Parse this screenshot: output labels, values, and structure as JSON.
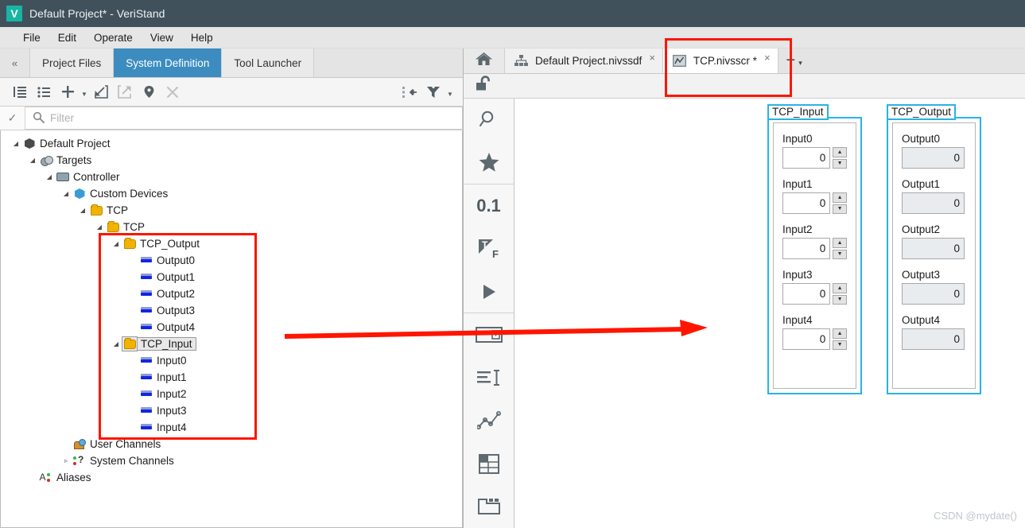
{
  "window": {
    "logo_letter": "V",
    "title": "Default Project* - VeriStand"
  },
  "menu": {
    "items": [
      {
        "label": "File"
      },
      {
        "label": "Edit"
      },
      {
        "label": "Operate"
      },
      {
        "label": "View"
      },
      {
        "label": "Help"
      }
    ]
  },
  "left_pane": {
    "collapse_label": "«",
    "tabs": [
      {
        "label": "Project Files",
        "active": false
      },
      {
        "label": "System Definition",
        "active": true
      },
      {
        "label": "Tool Launcher",
        "active": false
      }
    ],
    "toolbar": {
      "icons": [
        "collapse-all-icon",
        "list-view-icon",
        "add-icon",
        "add-dropdown-caret",
        "import-icon",
        "export-icon",
        "pin-icon",
        "delete-icon",
        "synchronize-icon",
        "filter-icon",
        "filter-dropdown-caret"
      ]
    },
    "filter": {
      "check_glyph": "✓",
      "placeholder": "Filter",
      "value": ""
    },
    "tree": [
      {
        "label": "Default Project",
        "depth": 0,
        "icon": "cube",
        "arrow": "expanded"
      },
      {
        "label": "Targets",
        "depth": 1,
        "icon": "targets",
        "arrow": "expanded"
      },
      {
        "label": "Controller",
        "depth": 2,
        "icon": "controller",
        "arrow": "expanded"
      },
      {
        "label": "Custom Devices",
        "depth": 3,
        "icon": "customdevice",
        "arrow": "expanded"
      },
      {
        "label": "TCP",
        "depth": 4,
        "icon": "folder",
        "arrow": "expanded"
      },
      {
        "label": "TCP",
        "depth": 5,
        "icon": "folder",
        "arrow": "expanded"
      },
      {
        "label": "TCP_Output",
        "depth": 6,
        "icon": "folder",
        "arrow": "expanded"
      },
      {
        "label": "Output0",
        "depth": 7,
        "icon": "channel",
        "arrow": "none"
      },
      {
        "label": "Output1",
        "depth": 7,
        "icon": "channel",
        "arrow": "none"
      },
      {
        "label": "Output2",
        "depth": 7,
        "icon": "channel",
        "arrow": "none"
      },
      {
        "label": "Output3",
        "depth": 7,
        "icon": "channel",
        "arrow": "none"
      },
      {
        "label": "Output4",
        "depth": 7,
        "icon": "channel",
        "arrow": "none"
      },
      {
        "label": "TCP_Input",
        "depth": 6,
        "icon": "folder",
        "arrow": "expanded",
        "selected": true
      },
      {
        "label": "Input0",
        "depth": 7,
        "icon": "channel",
        "arrow": "none"
      },
      {
        "label": "Input1",
        "depth": 7,
        "icon": "channel",
        "arrow": "none"
      },
      {
        "label": "Input2",
        "depth": 7,
        "icon": "channel",
        "arrow": "none"
      },
      {
        "label": "Input3",
        "depth": 7,
        "icon": "channel",
        "arrow": "none"
      },
      {
        "label": "Input4",
        "depth": 7,
        "icon": "channel",
        "arrow": "none"
      },
      {
        "label": "User Channels",
        "depth": 3,
        "icon": "userchannels",
        "arrow": "none"
      },
      {
        "label": "System Channels",
        "depth": 3,
        "icon": "systemchannels",
        "arrow": "collapsed"
      },
      {
        "label": "Aliases",
        "depth": 1,
        "icon": "aliases",
        "arrow": "none"
      }
    ]
  },
  "right_pane": {
    "home_tab": "home-icon",
    "tabs": [
      {
        "label": "Default Project.nivssdf",
        "icon": "sysdef-icon",
        "active": false,
        "close": "×"
      },
      {
        "label": "TCP.nivsscr *",
        "icon": "screen-icon",
        "active": true,
        "close": "×"
      }
    ],
    "new_tab": {
      "plus": "+",
      "caret": "▾"
    },
    "canvas_toolbar": {
      "lock_state": "unlock-icon"
    },
    "palette": [
      {
        "name": "zoom-icon",
        "glyph": "search"
      },
      {
        "name": "favorites-icon",
        "glyph": "star"
      },
      {
        "name": "numeric-icon",
        "glyph": "0.1"
      },
      {
        "name": "boolean-icon",
        "glyph": "TF"
      },
      {
        "name": "run-icon",
        "glyph": "play"
      },
      {
        "name": "combobox-icon",
        "glyph": "combo"
      },
      {
        "name": "string-icon",
        "glyph": "text"
      },
      {
        "name": "graph-icon",
        "glyph": "graph"
      },
      {
        "name": "table-icon",
        "glyph": "table"
      },
      {
        "name": "container-icon",
        "glyph": "container"
      }
    ]
  },
  "screen": {
    "input_panel": {
      "title": "TCP_Input",
      "controls": [
        {
          "label": "Input0",
          "value": "0"
        },
        {
          "label": "Input1",
          "value": "0"
        },
        {
          "label": "Input2",
          "value": "0"
        },
        {
          "label": "Input3",
          "value": "0"
        },
        {
          "label": "Input4",
          "value": "0"
        }
      ],
      "spinner_up": "▲",
      "spinner_down": "▼"
    },
    "output_panel": {
      "title": "TCP_Output",
      "controls": [
        {
          "label": "Output0",
          "value": "0"
        },
        {
          "label": "Output1",
          "value": "0"
        },
        {
          "label": "Output2",
          "value": "0"
        },
        {
          "label": "Output3",
          "value": "0"
        },
        {
          "label": "Output4",
          "value": "0"
        }
      ]
    }
  },
  "annotations": {
    "highlight_color": "#ff1500",
    "boxes": [
      {
        "name": "tree-channels-highlight"
      },
      {
        "name": "screen-tab-highlight"
      }
    ],
    "arrow": {
      "name": "tree-to-screen-arrow"
    }
  },
  "watermark": "CSDN @mydate()"
}
